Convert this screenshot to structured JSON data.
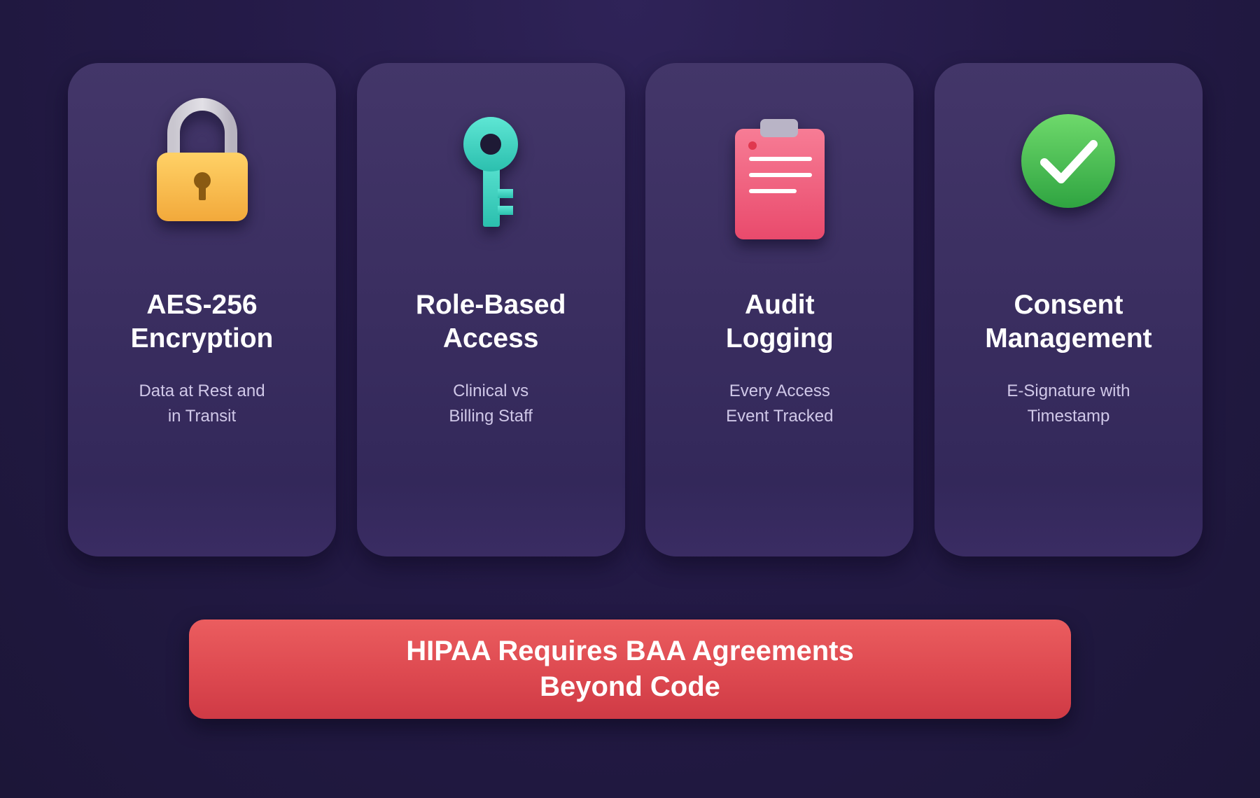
{
  "cards": [
    {
      "icon": "lock-icon",
      "title_line1": "AES-256",
      "title_line2": "Encryption",
      "subtitle_line1": "Data at Rest and",
      "subtitle_line2": "in Transit",
      "icon_color": "#f5b73f"
    },
    {
      "icon": "key-icon",
      "title_line1": "Role-Based",
      "title_line2": "Access",
      "subtitle_line1": "Clinical vs",
      "subtitle_line2": "Billing Staff",
      "icon_color": "#3fd2c1"
    },
    {
      "icon": "clipboard-icon",
      "title_line1": "Audit",
      "title_line2": "Logging",
      "subtitle_line1": "Every Access",
      "subtitle_line2": "Event Tracked",
      "icon_color": "#ef5a7a"
    },
    {
      "icon": "checkmark-circle-icon",
      "title_line1": "Consent",
      "title_line2": "Management",
      "subtitle_line1": "E-Signature with",
      "subtitle_line2": "Timestamp",
      "icon_color": "#45b84f"
    }
  ],
  "banner": {
    "line1": "HIPAA Requires BAA Agreements",
    "line2": "Beyond Code",
    "color": "#dd4950"
  },
  "colors": {
    "background": "#241a47",
    "card": "#3a2e60",
    "subtitle_text": "#d0c8e8"
  }
}
